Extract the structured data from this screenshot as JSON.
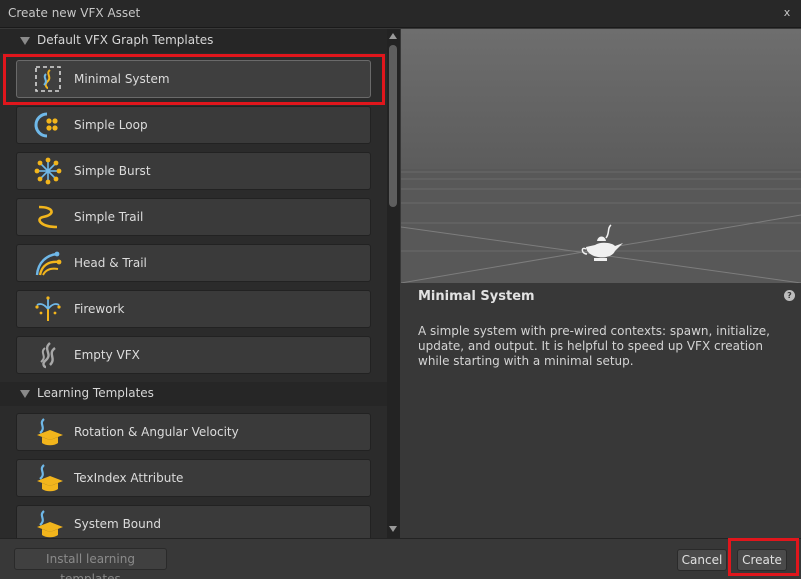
{
  "window": {
    "title": "Create new VFX Asset",
    "close_label": "x"
  },
  "sections": [
    {
      "label": "Default VFX Graph Templates"
    },
    {
      "label": "Learning Templates"
    }
  ],
  "default_templates": [
    {
      "label": "Minimal System",
      "icon": "minimal-system-icon"
    },
    {
      "label": "Simple Loop",
      "icon": "simple-loop-icon"
    },
    {
      "label": "Simple Burst",
      "icon": "simple-burst-icon"
    },
    {
      "label": "Simple Trail",
      "icon": "simple-trail-icon"
    },
    {
      "label": "Head & Trail",
      "icon": "head-trail-icon"
    },
    {
      "label": "Firework",
      "icon": "firework-icon"
    },
    {
      "label": "Empty VFX",
      "icon": "empty-vfx-icon"
    }
  ],
  "learning_templates": [
    {
      "label": "Rotation & Angular Velocity",
      "icon": "learning-cap-icon"
    },
    {
      "label": "TexIndex Attribute",
      "icon": "learning-cap-icon"
    },
    {
      "label": "System Bound",
      "icon": "learning-cap-icon"
    }
  ],
  "selected": {
    "title": "Minimal System",
    "description": "A simple system with pre-wired contexts: spawn, initialize, update, and output. It is helpful to speed up VFX creation while starting with a minimal setup."
  },
  "footer": {
    "install_label": "Install learning templates",
    "cancel_label": "Cancel",
    "create_label": "Create"
  },
  "colors": {
    "highlight": "#e0161c",
    "accent_yellow": "#f2b51c",
    "accent_blue": "#6fb8e8"
  }
}
